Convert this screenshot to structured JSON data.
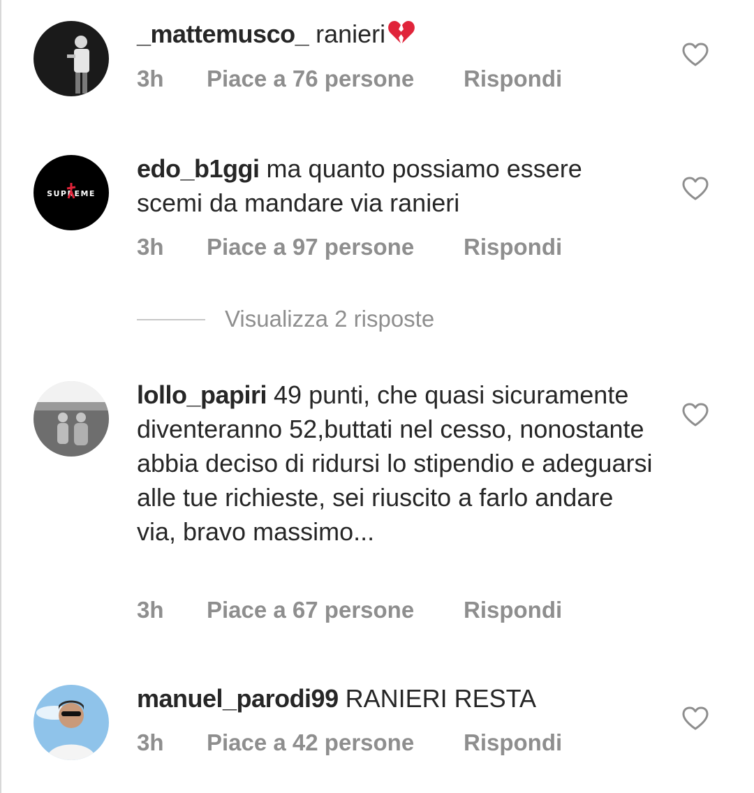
{
  "comments": [
    {
      "username": "_mattemusco_",
      "text": " ranieri",
      "emoji": "broken-heart",
      "time": "3h",
      "likes": "Piace a 76 persone",
      "reply": "Rispondi"
    },
    {
      "username": "edo_b1ggi",
      "text": " ma quanto possiamo essere scemi da mandare via ranieri",
      "avatar_text": "SUPREME",
      "time": "3h",
      "likes": "Piace a 97 persone",
      "reply": "Rispondi"
    },
    {
      "username": "lollo_papiri",
      "text": " 49 punti, che quasi sicuramente diventeranno 52,buttati nel cesso, nonostante abbia deciso di ridursi lo stipendio e adeguarsi alle tue richieste, sei riuscito a farlo andare via, bravo massimo...",
      "time": "3h",
      "likes": "Piace a 67 persone",
      "reply": "Rispondi"
    },
    {
      "username": "manuel_parodi99",
      "text": " RANIERI RESTA",
      "time": "3h",
      "likes": "Piace a 42 persone",
      "reply": "Rispondi"
    }
  ],
  "view_replies": "Visualizza 2 risposte",
  "colors": {
    "text": "#262626",
    "meta": "#8e8e8e",
    "divider": "#c7c7c7",
    "emoji": "#e0243a"
  },
  "icons": {
    "like": "heart-outline-icon",
    "emoji": "broken-heart-icon"
  }
}
